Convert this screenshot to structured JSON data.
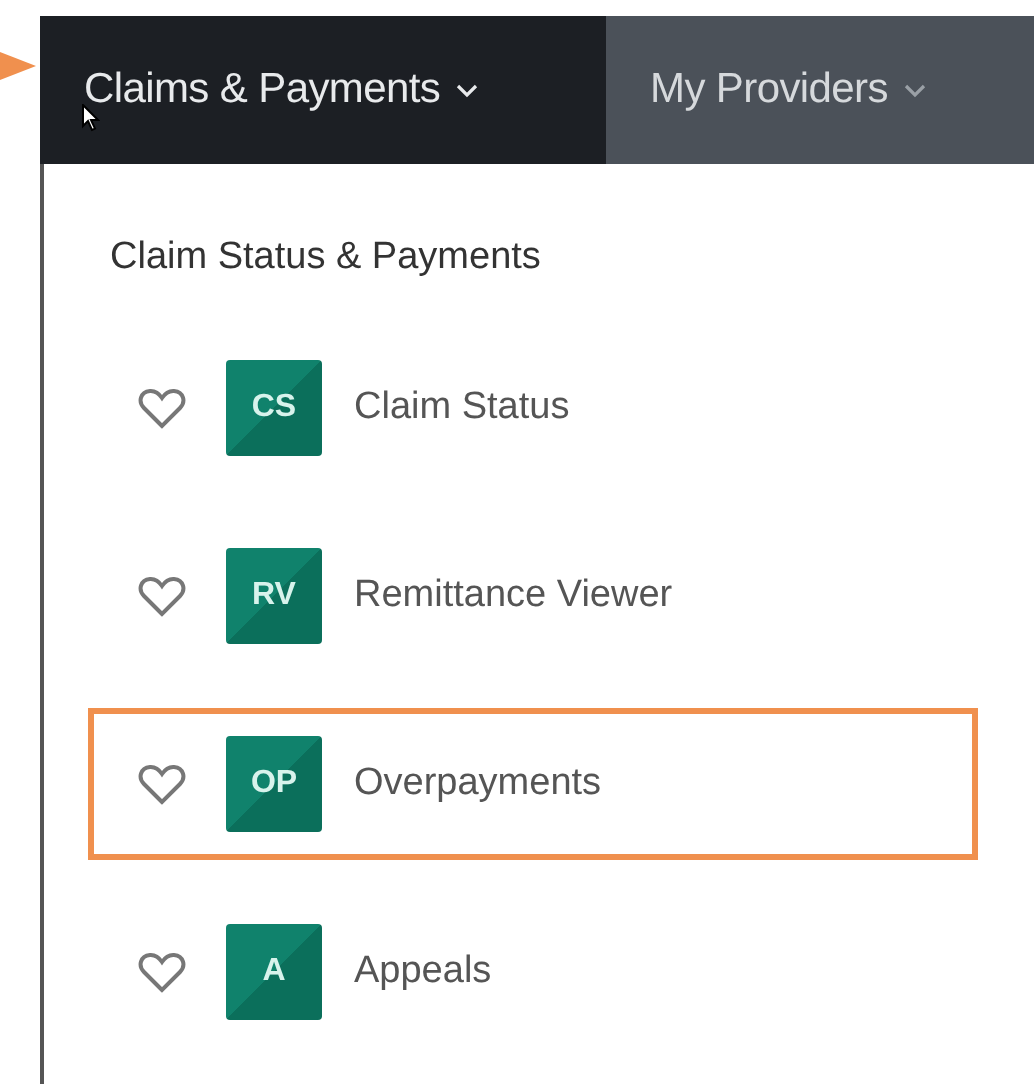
{
  "nav": {
    "tabs": [
      {
        "label": "Claims & Payments",
        "selected": true
      },
      {
        "label": "My Providers",
        "selected": false
      }
    ]
  },
  "menu": {
    "heading": "Claim Status & Payments",
    "items": [
      {
        "abbr": "CS",
        "label": "Claim Status",
        "favorite": false,
        "selected": false
      },
      {
        "abbr": "RV",
        "label": "Remittance Viewer",
        "favorite": false,
        "selected": false
      },
      {
        "abbr": "OP",
        "label": "Overpayments",
        "favorite": false,
        "selected": true
      },
      {
        "abbr": "A",
        "label": "Appeals",
        "favorite": false,
        "selected": false
      }
    ]
  }
}
